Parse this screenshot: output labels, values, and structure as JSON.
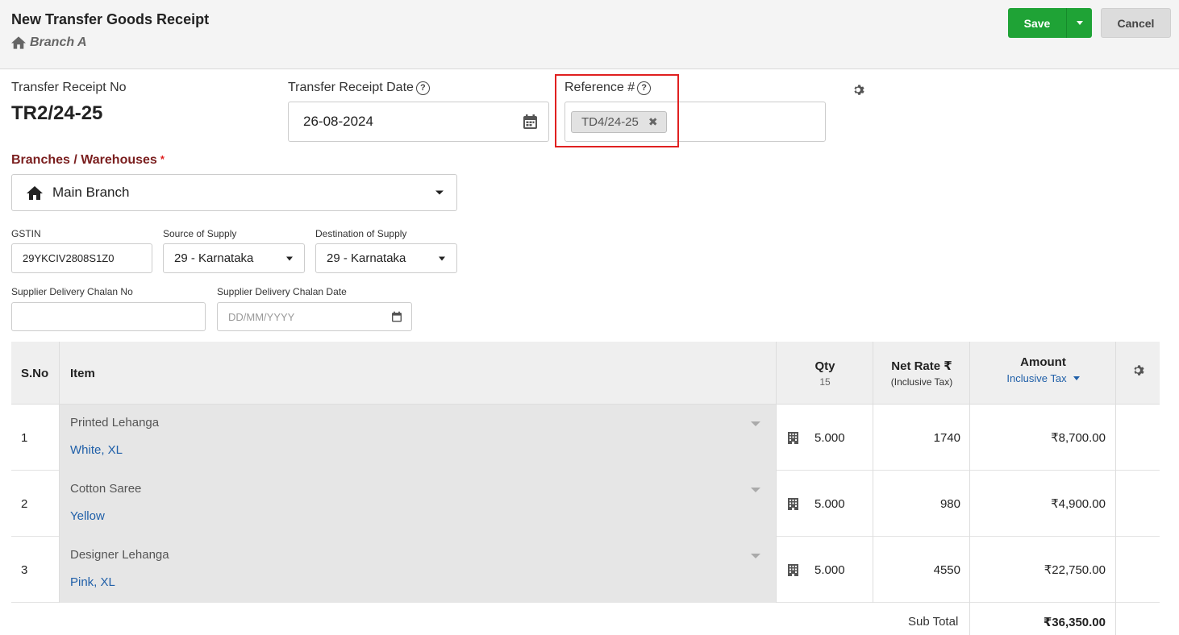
{
  "header": {
    "title": "New Transfer Goods Receipt",
    "branch": "Branch A",
    "save_label": "Save",
    "cancel_label": "Cancel"
  },
  "form": {
    "receipt_no_label": "Transfer Receipt No",
    "receipt_no_value": "TR2/24-25",
    "receipt_date_label": "Transfer Receipt Date",
    "receipt_date_value": "26-08-2024",
    "reference_label": "Reference #",
    "reference_tag": "TD4/24-25",
    "branches_label": "Branches / Warehouses",
    "required_mark": "*",
    "branch_value": "Main Branch",
    "gstin_label": "GSTIN",
    "gstin_value": "29YKCIV2808S1Z0",
    "source_label": "Source of Supply",
    "source_value": "29 - Karnataka",
    "destination_label": "Destination of Supply",
    "destination_value": "29 - Karnataka",
    "chalan_no_label": "Supplier Delivery Chalan No",
    "chalan_no_value": "",
    "chalan_date_label": "Supplier Delivery Chalan Date",
    "chalan_date_placeholder": "DD/MM/YYYY"
  },
  "table": {
    "headers": {
      "sno": "S.No",
      "item": "Item",
      "qty": "Qty",
      "qty_total": "15",
      "net_rate": "Net Rate ₹",
      "net_rate_sub": "(Inclusive Tax)",
      "amount": "Amount",
      "amount_sub": "Inclusive Tax"
    },
    "rows": [
      {
        "sno": "1",
        "item": "Printed Lehanga",
        "variant": "White, XL",
        "qty": "5.000",
        "rate": "1740",
        "amount": "₹8,700.00"
      },
      {
        "sno": "2",
        "item": "Cotton Saree",
        "variant": "Yellow",
        "qty": "5.000",
        "rate": "980",
        "amount": "₹4,900.00"
      },
      {
        "sno": "3",
        "item": "Designer Lehanga",
        "variant": "Pink, XL",
        "qty": "5.000",
        "rate": "4550",
        "amount": "₹22,750.00"
      }
    ],
    "subtotal_label": "Sub Total",
    "subtotal_value": "₹36,350.00"
  },
  "colors": {
    "save_green": "#1fa336",
    "highlight_red": "#e02020",
    "branches_label": "#7a1e1e",
    "link_blue": "#1f5fa8"
  }
}
